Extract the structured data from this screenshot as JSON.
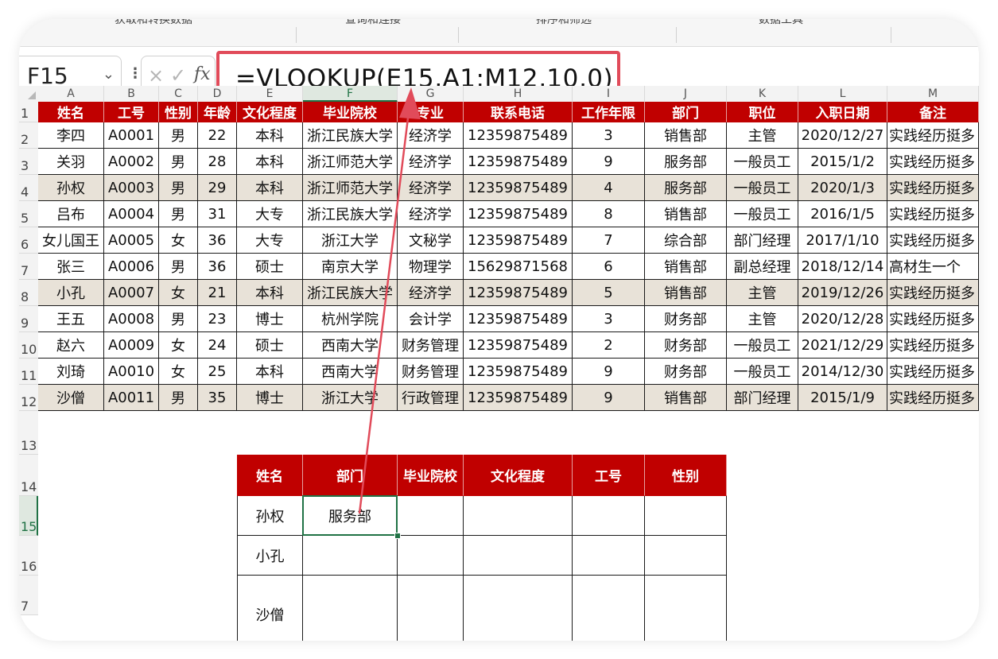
{
  "ribbon": {
    "groups": [
      "获取和转换数据",
      "查询和连接",
      "排序和筛选",
      "数据工具"
    ]
  },
  "formula_bar": {
    "name_box": "F15",
    "formula": "=VLOOKUP(E15,A1:M12,10,0)",
    "fx_label": "fx",
    "cancel_glyph": "×",
    "enter_glyph": "✓",
    "more_glyph": "⋮",
    "chevron_glyph": "⌄"
  },
  "columns": [
    "A",
    "B",
    "C",
    "D",
    "E",
    "F",
    "G",
    "H",
    "I",
    "J",
    "K",
    "L",
    "M"
  ],
  "selected_column": "F",
  "rows": [
    "1",
    "2",
    "3",
    "4",
    "5",
    "6",
    "7",
    "8",
    "9",
    "10",
    "11",
    "12",
    "13",
    "14",
    "15",
    "16",
    "7"
  ],
  "selected_row": "15",
  "main_table": {
    "headers": [
      "姓名",
      "工号",
      "性别",
      "年龄",
      "文化程度",
      "毕业院校",
      "专业",
      "联系电话",
      "工作年限",
      "部门",
      "职位",
      "入职日期",
      "备注"
    ],
    "rows": [
      [
        "李四",
        "A0001",
        "男",
        "22",
        "本科",
        "浙江民族大学",
        "经济学",
        "12359875489",
        "3",
        "销售部",
        "主管",
        "2020/12/27",
        "实践经历挺多"
      ],
      [
        "关羽",
        "A0002",
        "男",
        "28",
        "本科",
        "浙江师范大学",
        "经济学",
        "12359875489",
        "9",
        "服务部",
        "一般员工",
        "2015/1/2",
        "实践经历挺多"
      ],
      [
        "孙权",
        "A0003",
        "男",
        "29",
        "本科",
        "浙江师范大学",
        "经济学",
        "12359875489",
        "4",
        "服务部",
        "一般员工",
        "2020/1/3",
        "实践经历挺多"
      ],
      [
        "吕布",
        "A0004",
        "男",
        "31",
        "大专",
        "浙江民族大学",
        "经济学",
        "12359875489",
        "8",
        "销售部",
        "一般员工",
        "2016/1/5",
        "实践经历挺多"
      ],
      [
        "女儿国王",
        "A0005",
        "女",
        "36",
        "大专",
        "浙江大学",
        "文秘学",
        "12359875489",
        "7",
        "综合部",
        "部门经理",
        "2017/1/10",
        "实践经历挺多"
      ],
      [
        "张三",
        "A0006",
        "男",
        "36",
        "硕士",
        "南京大学",
        "物理学",
        "15629871568",
        "6",
        "销售部",
        "副总经理",
        "2018/12/14",
        "高材生一个"
      ],
      [
        "小孔",
        "A0007",
        "女",
        "21",
        "本科",
        "浙江民族大学",
        "经济学",
        "12359875489",
        "5",
        "销售部",
        "主管",
        "2019/12/26",
        "实践经历挺多"
      ],
      [
        "王五",
        "A0008",
        "男",
        "23",
        "博士",
        "杭州学院",
        "会计学",
        "12359875489",
        "3",
        "财务部",
        "主管",
        "2020/12/28",
        "实践经历挺多"
      ],
      [
        "赵六",
        "A0009",
        "女",
        "24",
        "硕士",
        "西南大学",
        "财务管理",
        "12359875489",
        "2",
        "财务部",
        "一般员工",
        "2021/12/29",
        "实践经历挺多"
      ],
      [
        "刘琦",
        "A0010",
        "女",
        "25",
        "本科",
        "西南大学",
        "财务管理",
        "12359875489",
        "9",
        "财务部",
        "一般员工",
        "2014/12/30",
        "实践经历挺多"
      ],
      [
        "沙僧",
        "A0011",
        "男",
        "35",
        "博士",
        "浙江大学",
        "行政管理",
        "12359875489",
        "9",
        "销售部",
        "部门经理",
        "2015/1/9",
        "实践经历挺多"
      ]
    ],
    "shaded_rows": [
      2,
      6,
      10
    ]
  },
  "lookup_table": {
    "headers": [
      "姓名",
      "部门",
      "毕业院校",
      "文化程度",
      "工号",
      "性别"
    ],
    "rows": [
      [
        "孙权",
        "服务部",
        "",
        "",
        "",
        ""
      ],
      [
        "小孔",
        "",
        "",
        "",
        "",
        ""
      ],
      [
        "沙僧",
        "",
        "",
        "",
        "",
        ""
      ]
    ]
  },
  "colors": {
    "header_red": "#c00000",
    "shade": "#e8e2d8",
    "highlight_box": "#e14b5a",
    "selection_green": "#207245"
  }
}
